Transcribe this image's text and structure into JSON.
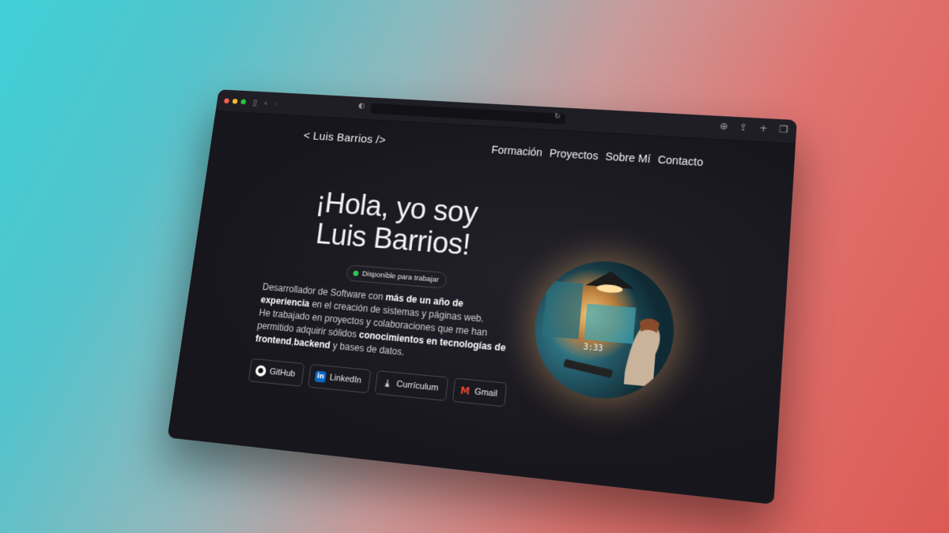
{
  "browser": {
    "toolbar_icons": [
      "sidebar-icon",
      "back-icon",
      "forward-icon",
      "shield-icon",
      "reload-icon",
      "download-icon",
      "share-icon",
      "new-tab-icon",
      "tabs-icon"
    ]
  },
  "site": {
    "logo": "< Luis Barrios />",
    "nav": [
      "Formación",
      "Proyectos",
      "Sobre Mí",
      "Contacto"
    ],
    "hero": {
      "line1": "¡Hola, yo soy",
      "line2": "Luis Barrios!"
    },
    "badge": "Disponible para trabajar",
    "bio": {
      "p1_pre": "Desarrollador de Software con ",
      "p1_bold": "más de un año de experiencia",
      "p1_post": " en el creación de sistemas y páginas web.",
      "p2_pre": "He trabajado en proyectos y colaboraciones que me han permitido adquirir sólidos ",
      "p2_bold1": "conocimientos en tecnologías de frontend",
      "p2_mid": ",",
      "p2_bold2": "backend",
      "p2_post": " y bases de datos."
    },
    "buttons": {
      "github": "GitHub",
      "linkedin": "LinkedIn",
      "cv": "Currículum",
      "gmail": "Gmail"
    },
    "avatar_clock": "3:33"
  },
  "colors": {
    "available_dot": "#34c759",
    "linkedin": "#0a66c2",
    "gmail": "#ea4335"
  }
}
